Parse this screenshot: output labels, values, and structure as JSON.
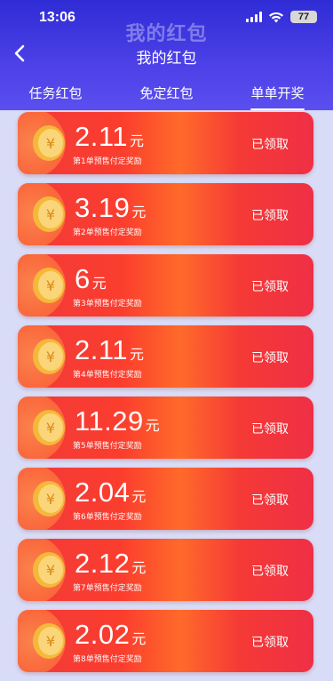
{
  "status_bar": {
    "time": "13:06",
    "battery": "77",
    "watermark": "我的红包"
  },
  "header": {
    "title": "我的红包"
  },
  "tabs": [
    {
      "label": "任务红包",
      "active": false
    },
    {
      "label": "免定红包",
      "active": false
    },
    {
      "label": "单单开奖",
      "active": true
    }
  ],
  "coupons": [
    {
      "amount": "2.11",
      "unit": "元",
      "desc": "第1单预售付定奖励",
      "status": "已领取"
    },
    {
      "amount": "3.19",
      "unit": "元",
      "desc": "第2单预售付定奖励",
      "status": "已领取"
    },
    {
      "amount": "6",
      "unit": "元",
      "desc": "第3单预售付定奖励",
      "status": "已领取"
    },
    {
      "amount": "2.11",
      "unit": "元",
      "desc": "第4单预售付定奖励",
      "status": "已领取"
    },
    {
      "amount": "11.29",
      "unit": "元",
      "desc": "第5单预售付定奖励",
      "status": "已领取"
    },
    {
      "amount": "2.04",
      "unit": "元",
      "desc": "第6单预售付定奖励",
      "status": "已领取"
    },
    {
      "amount": "2.12",
      "unit": "元",
      "desc": "第7单预售付定奖励",
      "status": "已领取"
    },
    {
      "amount": "2.02",
      "unit": "元",
      "desc": "第8单预售付定奖励",
      "status": "已领取"
    }
  ],
  "colors": {
    "header": "#3b34dc",
    "coupon": "#f23a3a",
    "coin": "#f5b93a"
  },
  "icons": {
    "back": "chevron-left-icon",
    "coin": "yuan-coin-icon"
  }
}
